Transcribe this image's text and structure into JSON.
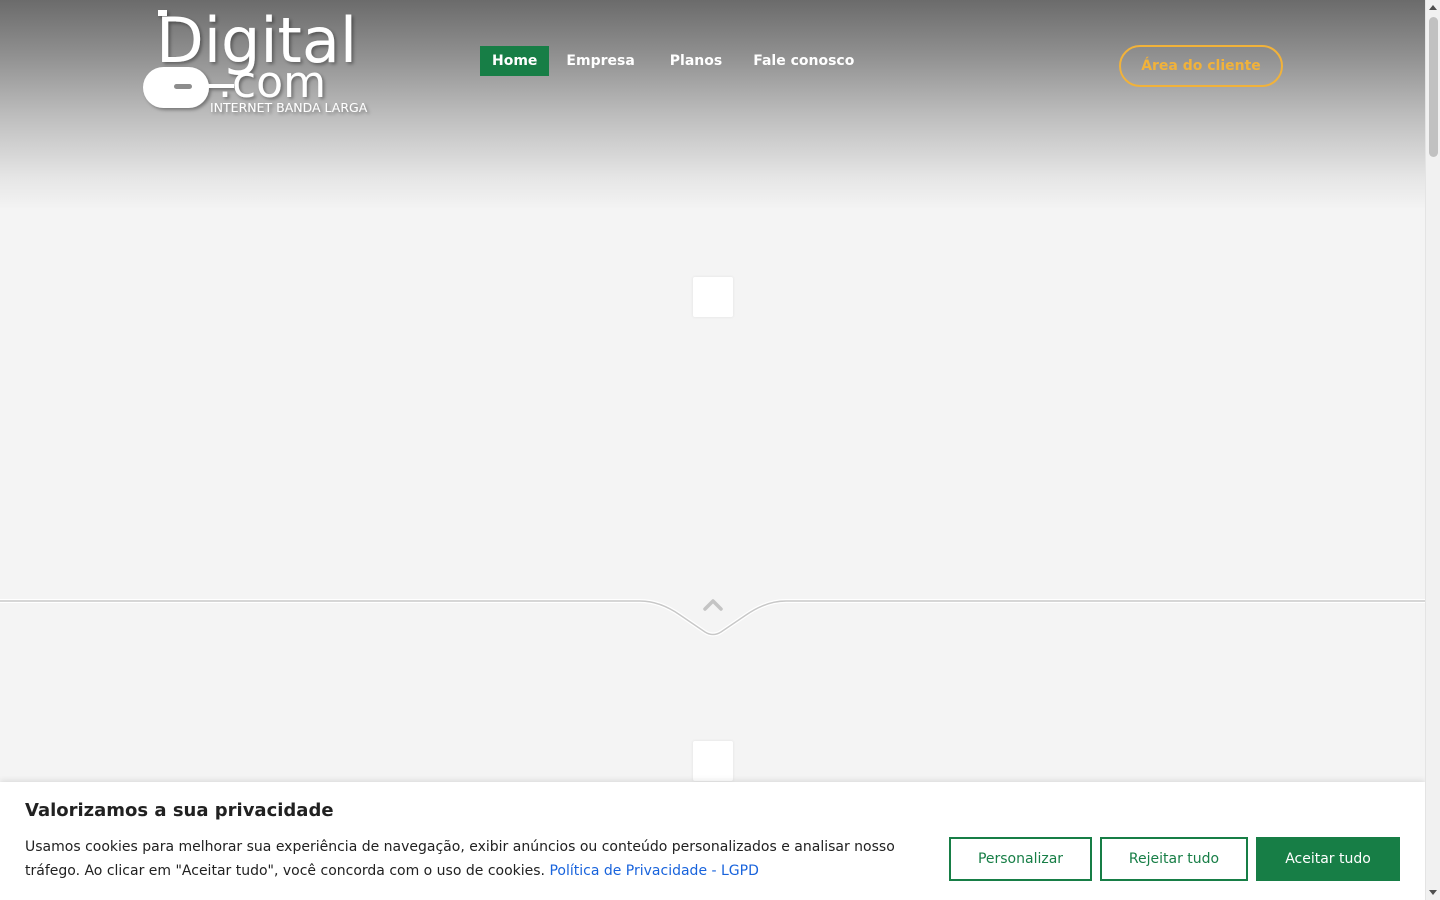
{
  "header": {
    "logo": {
      "wordmark": "Digital",
      "suffix": ".com",
      "tagline": "INTERNET BANDA LARGA"
    },
    "nav": [
      {
        "label": "Home",
        "active": true
      },
      {
        "label": "Empresa",
        "active": false
      },
      {
        "label": "Planos",
        "active": false
      },
      {
        "label": "Fale conosco",
        "active": false
      }
    ],
    "client_button": "Área do cliente"
  },
  "divider": {
    "icon": "chevron-up-icon"
  },
  "cookie_banner": {
    "title": "Valorizamos a sua privacidade",
    "text": "Usamos cookies para melhorar sua experiência de navegação, exibir anúncios ou conteúdo personalizados e analisar nosso tráfego. Ao clicar em \"Aceitar tudo\", você concorda com o uso de cookies.",
    "link": "Política de Privacidade - LGPD",
    "buttons": {
      "customize": "Personalizar",
      "reject": "Rejeitar tudo",
      "accept": "Aceitar tudo"
    }
  },
  "colors": {
    "brand_green": "#177e46",
    "accent_orange": "#f1b23a",
    "link_blue": "#1863dc"
  }
}
